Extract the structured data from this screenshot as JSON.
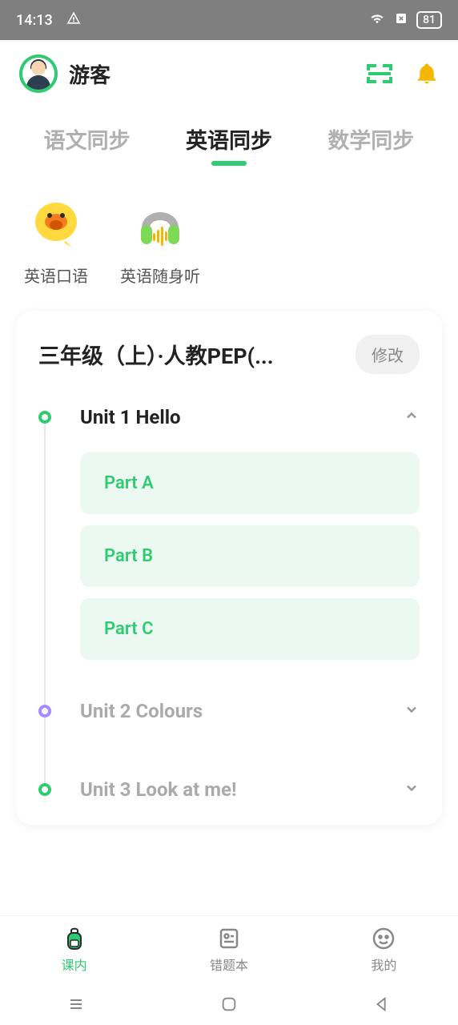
{
  "status": {
    "time": "14:13",
    "battery": "81"
  },
  "header": {
    "username": "游客"
  },
  "tabs": {
    "chinese": "语文同步",
    "english": "英语同步",
    "math": "数学同步"
  },
  "features": {
    "speaking": "英语口语",
    "listening": "英语随身听"
  },
  "card": {
    "title": "三年级（上）·人教PEP(...",
    "modify": "修改"
  },
  "units": [
    {
      "title": "Unit 1 Hello",
      "expanded": true,
      "parts": [
        "Part A",
        "Part B",
        "Part C"
      ]
    },
    {
      "title": "Unit 2 Colours",
      "expanded": false
    },
    {
      "title": "Unit 3 Look at me!",
      "expanded": false
    }
  ],
  "bottomNav": {
    "course": "课内",
    "mistakes": "错题本",
    "mine": "我的"
  }
}
